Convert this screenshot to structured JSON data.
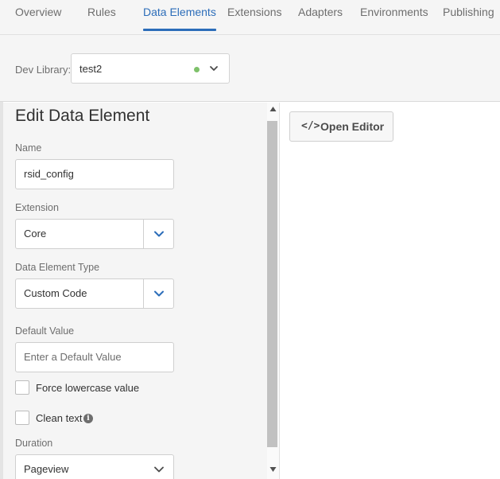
{
  "nav": {
    "tabs": [
      {
        "label": "Overview"
      },
      {
        "label": "Rules"
      },
      {
        "label": "Data Elements"
      },
      {
        "label": "Extensions"
      },
      {
        "label": "Adapters"
      },
      {
        "label": "Environments"
      },
      {
        "label": "Publishing"
      }
    ],
    "active_tab": "Data Elements"
  },
  "library": {
    "label": "Dev Library:",
    "value": "test2",
    "status_color": "#7ec16a"
  },
  "form": {
    "title": "Edit Data Element",
    "name": {
      "label": "Name",
      "value": "rsid_config"
    },
    "extension": {
      "label": "Extension",
      "value": "Core"
    },
    "type": {
      "label": "Data Element Type",
      "value": "Custom Code"
    },
    "default_value": {
      "label": "Default Value",
      "placeholder": "Enter a Default Value"
    },
    "force_lowercase": {
      "label": "Force lowercase value",
      "checked": false
    },
    "clean_text": {
      "label": "Clean text",
      "checked": false,
      "info_glyph": "i"
    },
    "duration": {
      "label": "Duration",
      "value": "Pageview"
    }
  },
  "editor": {
    "button_icon": "</>",
    "button_label": "Open Editor"
  },
  "colors": {
    "accent": "#2c6db9",
    "panel_bg": "#f5f5f5"
  }
}
